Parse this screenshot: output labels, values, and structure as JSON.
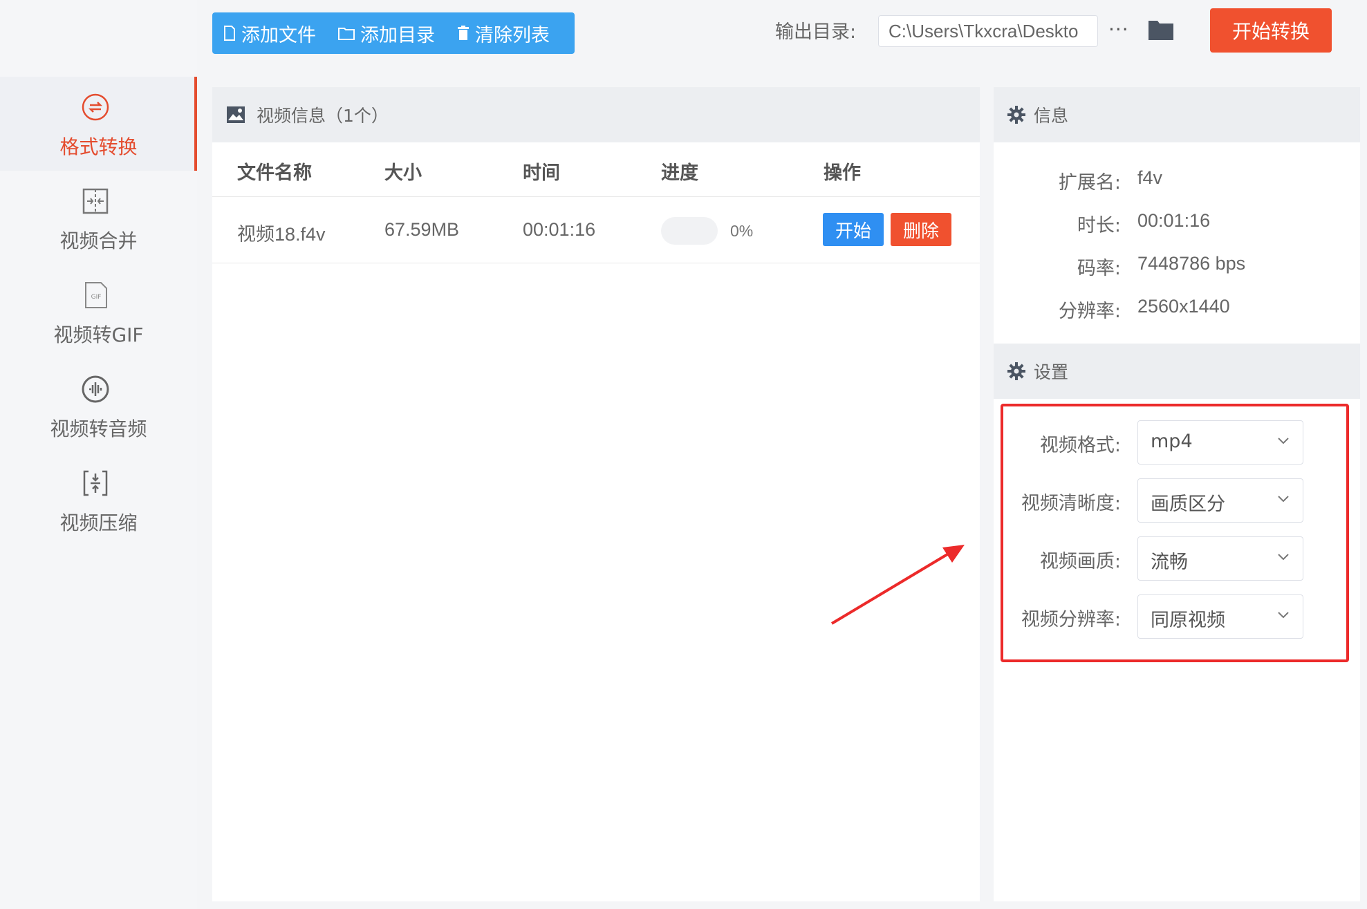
{
  "sidebar": {
    "items": [
      {
        "label": "格式转换",
        "icon": "format-convert-icon"
      },
      {
        "label": "视频合并",
        "icon": "merge-icon"
      },
      {
        "label": "视频转GIF",
        "icon": "gif-icon"
      },
      {
        "label": "视频转音频",
        "icon": "audio-icon"
      },
      {
        "label": "视频压缩",
        "icon": "compress-icon"
      }
    ]
  },
  "toolbar": {
    "add_file": "添加文件",
    "add_dir": "添加目录",
    "clear_list": "清除列表",
    "output_label": "输出目录:",
    "output_path": "C:\\Users\\Tkxcra\\Deskto",
    "more": "···",
    "start_all": "开始转换"
  },
  "video_panel": {
    "title": "视频信息（1个）",
    "columns": [
      "文件名称",
      "大小",
      "时间",
      "进度",
      "操作"
    ],
    "rows": [
      {
        "name": "视频18.f4v",
        "size": "67.59MB",
        "time": "00:01:16",
        "progress": "0%",
        "start": "开始",
        "delete": "删除"
      }
    ]
  },
  "info_panel": {
    "title": "信息",
    "rows": [
      {
        "key": "扩展名:",
        "value": "f4v"
      },
      {
        "key": "时长:",
        "value": "00:01:16"
      },
      {
        "key": "码率:",
        "value": "7448786 bps"
      },
      {
        "key": "分辨率:",
        "value": "2560x1440"
      }
    ]
  },
  "settings_panel": {
    "title": "设置",
    "fields": [
      {
        "label": "视频格式:",
        "value": "mp4"
      },
      {
        "label": "视频清晰度:",
        "value": "画质区分"
      },
      {
        "label": "视频画质:",
        "value": "流畅"
      },
      {
        "label": "视频分辨率:",
        "value": "同原视频"
      }
    ]
  },
  "colors": {
    "accent_red": "#e44c2e",
    "toolbar_blue": "#3ba3f0",
    "start_blue": "#2f8ff2",
    "delete_red": "#f0512f",
    "annotation_red": "#ec2a2a"
  }
}
